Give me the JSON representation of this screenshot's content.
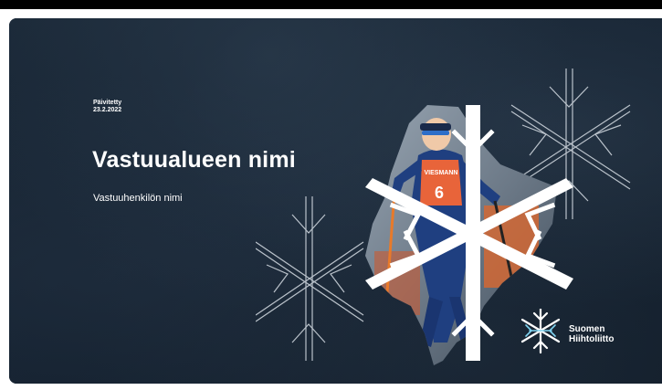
{
  "slide": {
    "updated_label": "Päivitetty",
    "updated_date": "23.2.2022",
    "title": "Vastuualueen nimi",
    "subtitle": "Vastuuhenkilön nimi"
  },
  "logo": {
    "line1": "Suomen",
    "line2": "Hiihtoliitto",
    "icon": "snowflake-logo-icon"
  },
  "photo": {
    "bib_number": "6",
    "sponsor_text": "VIESMANN",
    "icon": "skier-photo"
  },
  "colors": {
    "background": "#16222f",
    "snowflake": "#ffffff",
    "logo_accent": "#7fd3f0",
    "bib": "#e8643a"
  }
}
